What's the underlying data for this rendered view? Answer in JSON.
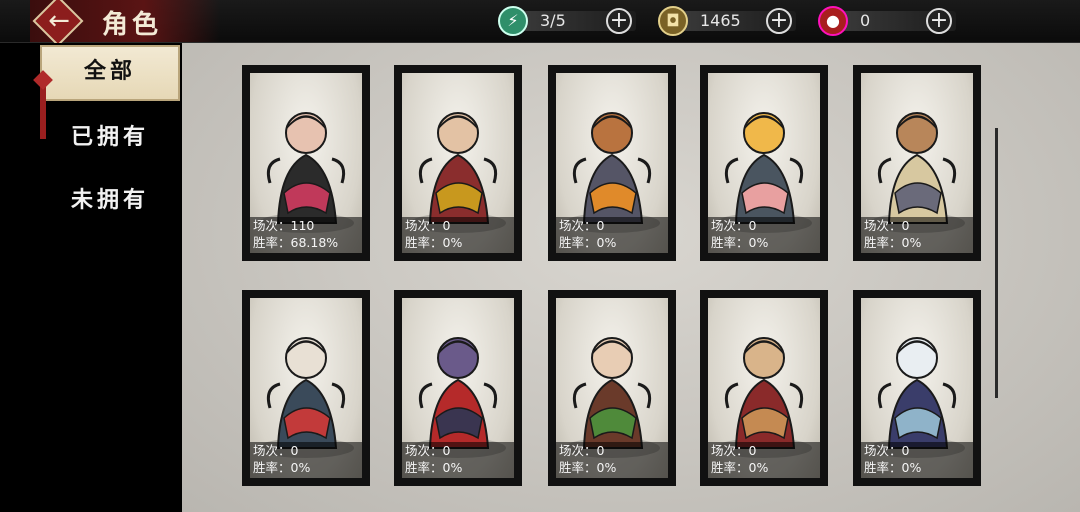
{
  "header": {
    "back_icon": "back-arrow-icon",
    "title": "角色"
  },
  "resources": [
    {
      "name": "stamina",
      "icon": "lightning-icon",
      "value": "3/5",
      "color": "#3fb38a"
    },
    {
      "name": "coins",
      "icon": "coin-icon",
      "value": "1465",
      "color": "#c8a24a"
    },
    {
      "name": "premium",
      "icon": "red-gourd-icon",
      "value": "0",
      "color": "#c92b2b"
    }
  ],
  "sidebar": {
    "tabs": [
      {
        "label": "全部",
        "selected": true
      },
      {
        "label": "已拥有",
        "selected": false
      },
      {
        "label": "未拥有",
        "selected": false
      }
    ]
  },
  "cards": [
    {
      "matches": "场次：110",
      "winrate": "胜率：68.18%",
      "palette": [
        "#c0395a",
        "#2b2b2b",
        "#e7c2b0"
      ]
    },
    {
      "matches": "场次：0",
      "winrate": "胜率：0%",
      "palette": [
        "#c8981e",
        "#8a2d2d",
        "#e3c2a4"
      ]
    },
    {
      "matches": "场次：0",
      "winrate": "胜率：0%",
      "palette": [
        "#e08a2a",
        "#555566",
        "#b9733f"
      ]
    },
    {
      "matches": "场次：0",
      "winrate": "胜率：0%",
      "palette": [
        "#e8a0a0",
        "#4a5560",
        "#f0b84a"
      ]
    },
    {
      "matches": "场次：0",
      "winrate": "胜率：0%",
      "palette": [
        "#6a6a7a",
        "#d7c8a0",
        "#b8865a"
      ]
    },
    {
      "matches": "场次：0",
      "winrate": "胜率：0%",
      "palette": [
        "#c23a3a",
        "#3a4a5a",
        "#e8e0d4"
      ]
    },
    {
      "matches": "场次：0",
      "winrate": "胜率：0%",
      "palette": [
        "#3a3550",
        "#b52a2a",
        "#6a5a8a"
      ]
    },
    {
      "matches": "场次：0",
      "winrate": "胜率：0%",
      "palette": [
        "#4f8a3a",
        "#6a3a2a",
        "#e8cdb4"
      ]
    },
    {
      "matches": "场次：0",
      "winrate": "胜率：0%",
      "palette": [
        "#c58a52",
        "#8a2a2a",
        "#d9b48a"
      ]
    },
    {
      "matches": "场次：0",
      "winrate": "胜率：0%",
      "palette": [
        "#8fb3c9",
        "#3a3d6a",
        "#e9eef2"
      ]
    }
  ]
}
